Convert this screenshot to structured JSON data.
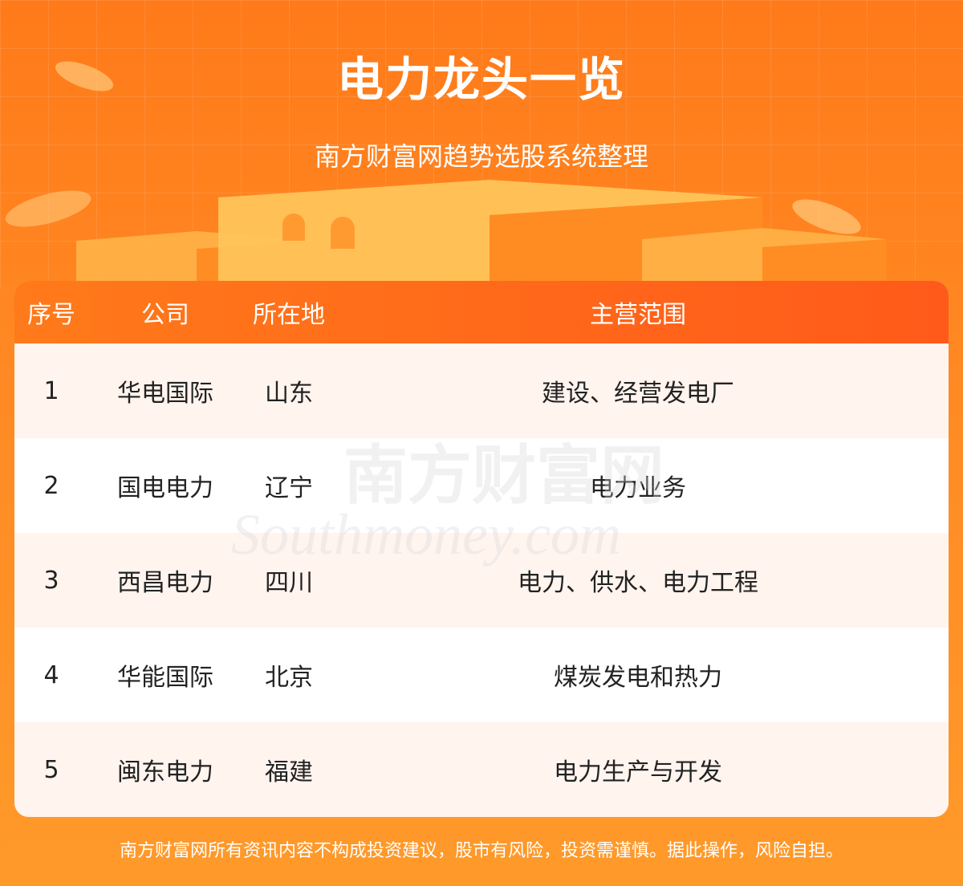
{
  "header": {
    "title": "电力龙头一览",
    "subtitle": "南方财富网趋势选股系统整理"
  },
  "table": {
    "columns": [
      "序号",
      "公司",
      "所在地",
      "主营范围"
    ],
    "rows": [
      {
        "no": "1",
        "company": "华电国际",
        "location": "山东",
        "business": "建设、经营发电厂"
      },
      {
        "no": "2",
        "company": "国电电力",
        "location": "辽宁",
        "business": "电力业务"
      },
      {
        "no": "3",
        "company": "西昌电力",
        "location": "四川",
        "business": "电力、供水、电力工程"
      },
      {
        "no": "4",
        "company": "华能国际",
        "location": "北京",
        "business": "煤炭发电和热力"
      },
      {
        "no": "5",
        "company": "闽东电力",
        "location": "福建",
        "business": "电力生产与开发"
      }
    ]
  },
  "watermark": {
    "cn": "南方财富网",
    "en": "Southmoney.com"
  },
  "footer": {
    "disclaimer": "南方财富网所有资讯内容不构成投资建议，股市有风险，投资需谨慎。据此操作，风险自担。"
  },
  "colors": {
    "header_bg": "#ff7a1a",
    "table_header": "#ff5a1a",
    "row_tint": "#fff4ee"
  }
}
